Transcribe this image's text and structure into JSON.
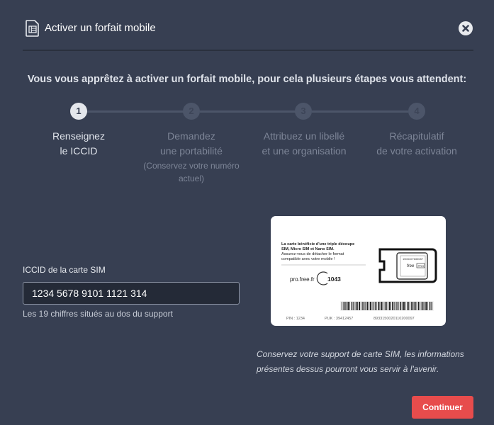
{
  "header": {
    "title": "Activer un forfait mobile",
    "icon": "sim-card-icon",
    "close_icon": "close-icon"
  },
  "intro_text": "Vous vous apprêtez à activer un forfait mobile, pour cela plusieurs étapes vous attendent:",
  "steps": [
    {
      "number": "1",
      "line1": "Renseignez",
      "line2": "le ICCID",
      "sub": "",
      "active": true
    },
    {
      "number": "2",
      "line1": "Demandez",
      "line2": "une portabilité",
      "sub": "(Conservez votre numéro actuel)",
      "active": false
    },
    {
      "number": "3",
      "line1": "Attribuez un libellé",
      "line2": "et une organisation",
      "sub": "",
      "active": false
    },
    {
      "number": "4",
      "line1": "Récapitulatif",
      "line2": "de votre activation",
      "sub": "",
      "active": false
    }
  ],
  "form": {
    "label": "ICCID de la carte SIM",
    "value": "1234 5678 9101 1121 314",
    "help": "Les 19 chiffres situés au dos du support"
  },
  "sim_card": {
    "text_line1": "La carte bénéficie d'une triple découpe",
    "text_line2": "SIM, Micro SIM et Nano SIM.",
    "text_line3": "Assurez-vous de détacher le format",
    "text_line4": "compatible avec votre mobile !",
    "website": "pro.free.fr",
    "support_number": "1043",
    "pin_label": "PIN : 1234",
    "puk_label": "PUK : 39412457",
    "barcode_number": "8933150020110200097",
    "chip_serial": "1503107630087",
    "brand": "free",
    "brand_suffix": "PRO"
  },
  "note": "Conservez votre support de carte SIM, les informations présentes dessus pourront vous servir à l'avenir.",
  "actions": {
    "continue_label": "Continuer"
  },
  "colors": {
    "background": "#373f52",
    "accent": "#e74c4c",
    "step_active": "#e4e7ec",
    "step_inactive": "#4c5569"
  }
}
